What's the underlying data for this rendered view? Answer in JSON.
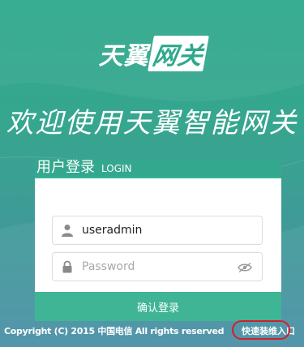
{
  "logo": {
    "main": "天翼",
    "accent": "网关"
  },
  "headline": "欢迎使用天翼智能网关",
  "login": {
    "title_zh": "用户登录",
    "title_en": "LOGIN",
    "username": {
      "value": "useradmin",
      "placeholder": ""
    },
    "password": {
      "value": "",
      "placeholder": "Password"
    },
    "submit_label": "确认登录"
  },
  "footer": {
    "copyright": "Copyright (C) 2015 中国电信 All rights reserved",
    "quick_link": "快速装维入口"
  },
  "icons": {
    "user": "user-icon",
    "lock": "lock-icon",
    "eye": "eye-slash-icon"
  },
  "colors": {
    "background": "#2ea98c",
    "button": "#3fb596",
    "highlight": "#d61e2a"
  }
}
